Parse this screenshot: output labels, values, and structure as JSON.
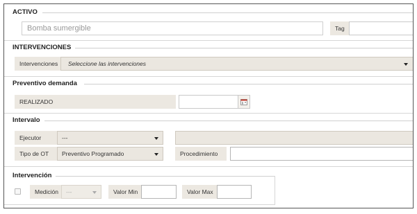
{
  "activo": {
    "title": "ACTIVO",
    "asset_value": "Bomba sumergible",
    "tag_label": "Tag",
    "tag_value": ""
  },
  "intervenciones": {
    "title": "INTERVENCIONES",
    "label": "Intervenciones",
    "placeholder": "Seleccione las intervenciones"
  },
  "preventivo": {
    "title": "Preventivo demanda",
    "status_label": "REALIZADO",
    "date_value": ""
  },
  "intervalo": {
    "title": "Intervalo",
    "ejecutor_label": "Ejecutor",
    "ejecutor_value": "---",
    "tipo_ot_label": "Tipo de OT",
    "tipo_ot_value": "Preventivo Programado",
    "procedimiento_label": "Procedimiento",
    "procedimiento_value": ""
  },
  "intervencion": {
    "title": "Intervención",
    "medicion_label": "Medición",
    "medicion_value": "---",
    "valor_min_label": "Valor Min",
    "valor_min_value": "",
    "valor_max_label": "Valor Max",
    "valor_max_value": ""
  },
  "colors": {
    "label_bg": "#ece8e1",
    "select_bg": "#ebe7e0",
    "border": "#c9c9c9",
    "divider": "#cfcfcf"
  }
}
